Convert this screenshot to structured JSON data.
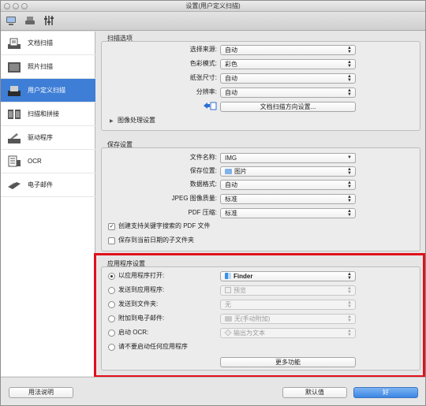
{
  "window": {
    "title": "设置(用户定义扫描)"
  },
  "toolbar": {
    "items": [
      {
        "icon": "scan-from-computer-icon"
      },
      {
        "icon": "scan-from-panel-icon"
      },
      {
        "icon": "general-settings-icon"
      }
    ]
  },
  "sidebar": {
    "items": [
      {
        "label": "文档扫描",
        "icon": "document-scan-icon"
      },
      {
        "label": "照片扫描",
        "icon": "photo-scan-icon"
      },
      {
        "label": "用户定义扫描",
        "icon": "custom-scan-icon",
        "selected": true
      },
      {
        "label": "扫描和拼接",
        "icon": "scan-and-stitch-icon"
      },
      {
        "label": "驱动程序",
        "icon": "driver-icon"
      },
      {
        "label": "OCR",
        "icon": "ocr-icon"
      },
      {
        "label": "电子邮件",
        "icon": "email-icon"
      }
    ]
  },
  "scan_options": {
    "title": "扫描选项",
    "source": {
      "label": "选择来源:",
      "value": "自动"
    },
    "color_mode": {
      "label": "色彩模式:",
      "value": "彩色"
    },
    "paper_size": {
      "label": "纸张尺寸:",
      "value": "自动"
    },
    "resolution": {
      "label": "分辨率:",
      "value": "自动"
    },
    "orientation_button": "文档扫描方向设置...",
    "image_processing": "图像处理设置"
  },
  "save_settings": {
    "title": "保存设置",
    "file_name": {
      "label": "文件名称:",
      "value": "IMG"
    },
    "save_in": {
      "label": "保存位置:",
      "value": "图片"
    },
    "data_format": {
      "label": "数据格式:",
      "value": "自动"
    },
    "jpeg_quality": {
      "label": "JPEG 图像质量:",
      "value": "标准"
    },
    "pdf_compression": {
      "label": "PDF 压缩:",
      "value": "标准"
    },
    "create_pdf_keyword": {
      "label": "创建支持关键字搜索的 PDF 文件",
      "checked": true
    },
    "save_to_date_subfolder": {
      "label": "保存到当前日期的子文件夹",
      "checked": false
    }
  },
  "app_settings": {
    "title": "应用程序设置",
    "options": [
      {
        "label": "以应用程序打开:",
        "value": "Finder",
        "selected": true,
        "enabled": true,
        "icon": "finder-icon"
      },
      {
        "label": "发送到应用程序:",
        "value": "预览",
        "selected": false,
        "enabled": false,
        "icon": "preview-icon"
      },
      {
        "label": "发送到文件夹:",
        "value": "无",
        "selected": false,
        "enabled": false
      },
      {
        "label": "附加到电子邮件:",
        "value": "无(手动附加)",
        "selected": false,
        "enabled": false,
        "icon": "folder-icon"
      },
      {
        "label": "启动 OCR:",
        "value": "输出为文本",
        "selected": false,
        "enabled": false,
        "icon": "ocr-app-icon"
      },
      {
        "label": "请不要启动任何应用程序",
        "selected": false
      }
    ],
    "more_functions": "更多功能"
  },
  "footer": {
    "instructions": "用法说明",
    "defaults": "默认值",
    "ok": "好"
  },
  "colors": {
    "accent": "#3e7ed6",
    "highlight": "#e0101c"
  }
}
